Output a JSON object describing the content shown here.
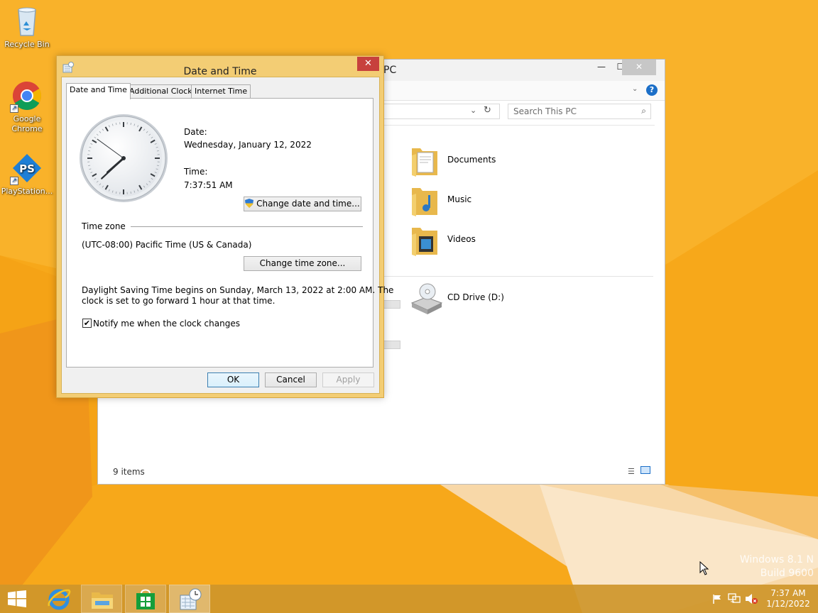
{
  "desktop": {
    "icons": [
      {
        "label": "Recycle Bin",
        "icon": "recycle-bin-icon"
      },
      {
        "label": "Google Chrome",
        "icon": "chrome-icon"
      },
      {
        "label": "PlayStation...",
        "icon": "playstation-icon"
      }
    ],
    "watermark": {
      "line1": "Windows 8.1 N",
      "line2": "Build 9600"
    }
  },
  "explorer": {
    "title": "PC",
    "search_placeholder": "Search This PC",
    "folders": [
      {
        "label": "Documents",
        "icon": "documents-folder-icon"
      },
      {
        "label": "Music",
        "icon": "music-folder-icon"
      },
      {
        "label": "Videos",
        "icon": "videos-folder-icon"
      }
    ],
    "drives": [
      {
        "label": "CD Drive (D:)",
        "icon": "cd-drive-icon"
      }
    ],
    "status": "9 items"
  },
  "dialog": {
    "title": "Date and Time",
    "tabs": [
      "Date and Time",
      "Additional Clocks",
      "Internet Time"
    ],
    "active_tab": "Date and Time",
    "date_label": "Date:",
    "date_value": "Wednesday, January 12, 2022",
    "time_label": "Time:",
    "time_value": "7:37:51 AM",
    "change_datetime_button": "Change date and time...",
    "timezone_heading": "Time zone",
    "timezone_value": "(UTC-08:00) Pacific Time (US & Canada)",
    "change_timezone_button": "Change time zone...",
    "dst_line1": "Daylight Saving Time begins on Sunday, March 13, 2022 at 2:00 AM. The",
    "dst_line2": "clock is set to go forward 1 hour at that time.",
    "notify_label": "Notify me when the clock changes",
    "notify_checked": true,
    "ok": "OK",
    "cancel": "Cancel",
    "apply": "Apply",
    "clock": {
      "hour": 7,
      "minute": 37,
      "second": 51
    }
  },
  "taskbar": {
    "clock_time": "7:37 AM",
    "clock_date": "1/12/2022"
  },
  "colors": {
    "desktop": "#f7a81a",
    "dialog_frame": "#f3cd74",
    "close_red": "#c7413d",
    "taskbar": "#ce962a"
  }
}
